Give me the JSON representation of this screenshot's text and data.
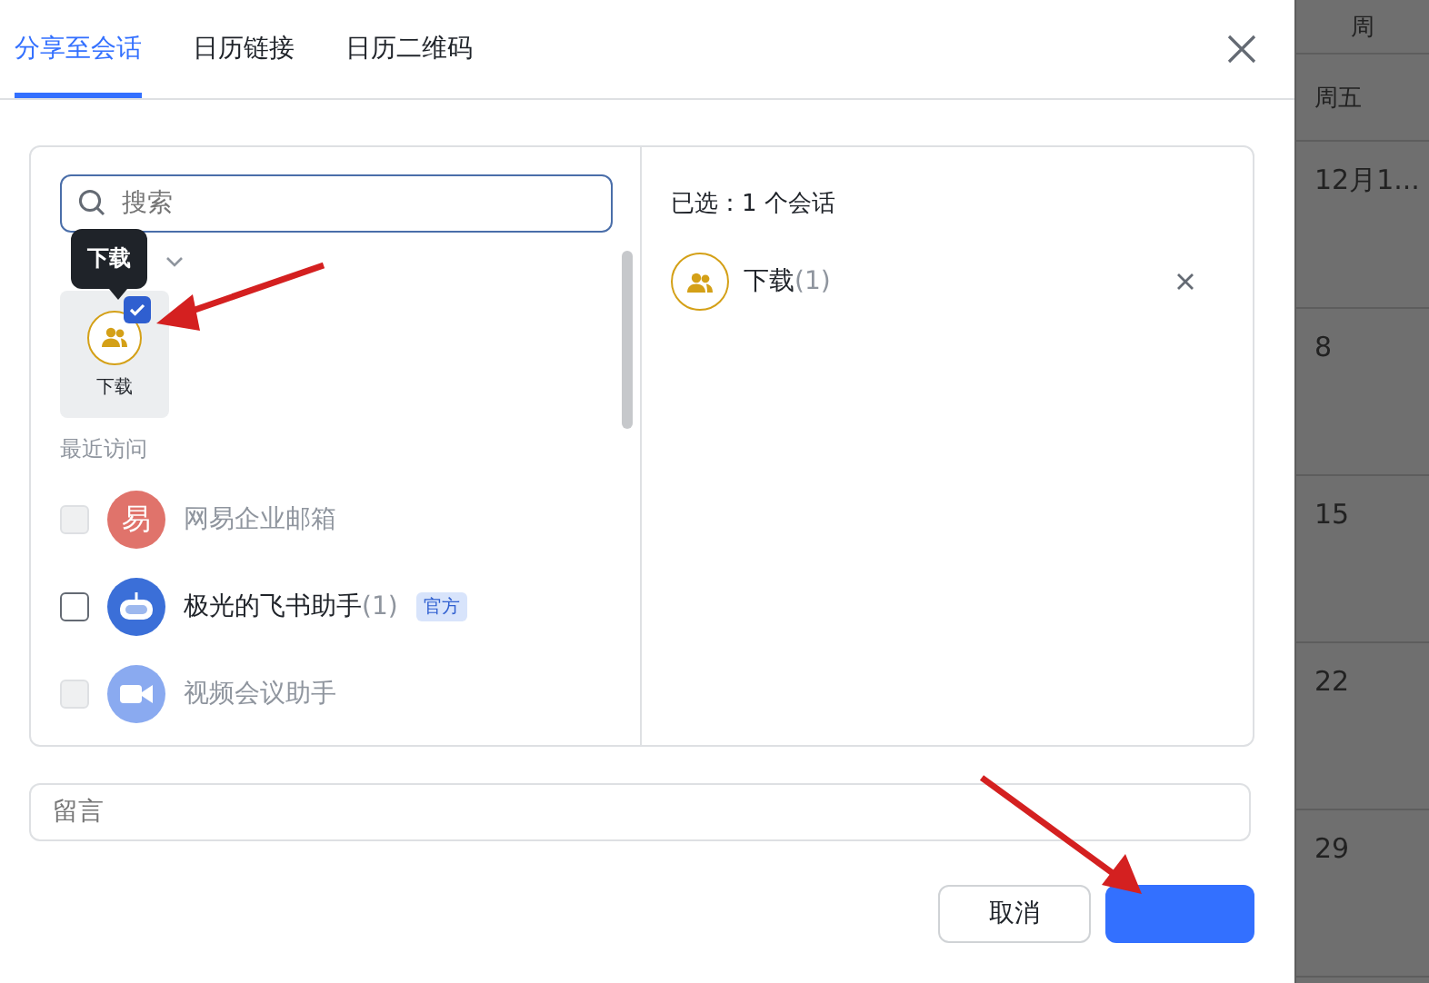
{
  "tabs": [
    {
      "label": "分享至会话",
      "selected": true
    },
    {
      "label": "日历链接",
      "selected": false
    },
    {
      "label": "日历二维码",
      "selected": false
    }
  ],
  "search": {
    "placeholder": "搜索"
  },
  "group_tile": {
    "label": "下载",
    "checked": true,
    "tooltip": "下载"
  },
  "recent_label": "最近访问",
  "recent": [
    {
      "name": "网易企业邮箱",
      "kind": "letter",
      "avatar_text": "易",
      "color": "#e0736b",
      "disabled": true,
      "checked": false
    },
    {
      "name": "极光的飞书助手",
      "count": "(1)",
      "badge": "官方",
      "kind": "bot",
      "color": "#3b6fd8",
      "disabled": false,
      "checked": false
    },
    {
      "name": "视频会议助手",
      "kind": "video",
      "color": "#8aaaf0",
      "disabled": true,
      "checked": false
    }
  ],
  "selected_summary": "已选：1 个会话",
  "selected_items": [
    {
      "name": "下载",
      "count": "(1)"
    }
  ],
  "message": {
    "placeholder": "留言"
  },
  "buttons": [
    {
      "label": "取消",
      "kind": "secondary"
    },
    {
      "kind": "primary"
    }
  ],
  "calendar": {
    "header": "周",
    "weekday": "周五",
    "dates": [
      "12月1...",
      "8",
      "15",
      "22",
      "29"
    ]
  }
}
